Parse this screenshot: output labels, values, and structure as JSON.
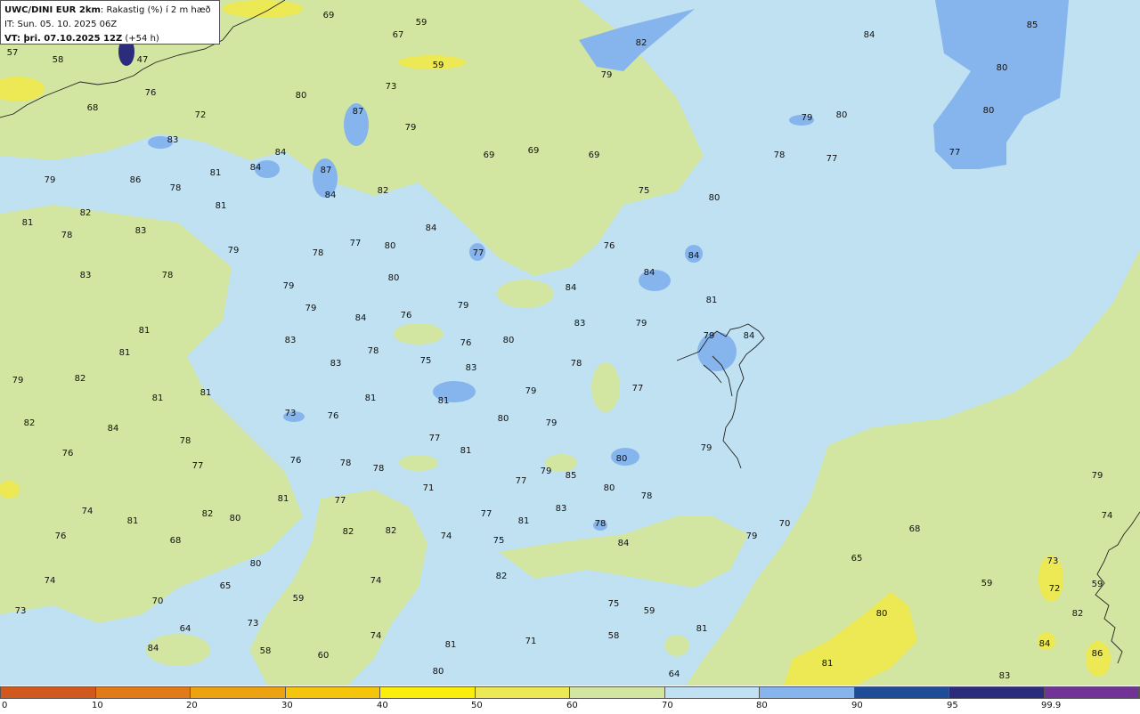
{
  "header": {
    "model": "UWC/DINI EUR 2km",
    "parameter": ": Rakastig (%) í 2 m hæð",
    "it": "IT: Sun. 05. 10. 2025 06Z",
    "vt": "VT: þri. 07.10.2025 12Z",
    "lead": " (+54 h)"
  },
  "legend": {
    "colors": [
      "#d2591e",
      "#e27a18",
      "#eda212",
      "#f5c50c",
      "#fbee0a",
      "#ece954",
      "#d2e6a1",
      "#bfe1f2",
      "#86b5ee",
      "#1f4c96",
      "#2b2d7c",
      "#723396"
    ],
    "ticks": [
      "0",
      "10",
      "20",
      "30",
      "40",
      "50",
      "60",
      "70",
      "80",
      "90",
      "95",
      "99.9"
    ]
  },
  "fill_colors": {
    "ocean": "#bfe1f2",
    "dry": "#d2e6a1",
    "humid": "#86b5ee",
    "very_dry": "#ece954",
    "extreme": "#2b2d7c"
  },
  "values": [
    "69",
    "59",
    "67",
    "59",
    "57",
    "58",
    "47",
    "76",
    "80",
    "73",
    "68",
    "72",
    "87",
    "79",
    "83",
    "69",
    "69",
    "69",
    "84",
    "87",
    "84",
    "86",
    "78",
    "81",
    "84",
    "82",
    "79",
    "81",
    "75",
    "80",
    "82",
    "81",
    "78",
    "83",
    "79",
    "78",
    "77",
    "80",
    "84",
    "77",
    "79",
    "78",
    "80",
    "79",
    "76",
    "84",
    "84",
    "84",
    "76",
    "81",
    "83",
    "84",
    "79",
    "81",
    "80",
    "83",
    "79",
    "76",
    "83",
    "81",
    "76",
    "78",
    "78",
    "77",
    "81",
    "75",
    "79",
    "84",
    "79",
    "82",
    "83",
    "83",
    "81",
    "79",
    "81",
    "80",
    "79",
    "84",
    "77",
    "81",
    "81",
    "82",
    "73",
    "76",
    "78",
    "77",
    "80",
    "79",
    "79",
    "77",
    "85",
    "80",
    "78",
    "76",
    "78",
    "78",
    "71",
    "74",
    "81",
    "77",
    "77",
    "81",
    "83",
    "78",
    "84",
    "81",
    "82",
    "80",
    "82",
    "82",
    "74",
    "75",
    "76",
    "68",
    "80",
    "82",
    "79",
    "70",
    "68",
    "65",
    "65",
    "74",
    "74",
    "79",
    "74",
    "59",
    "59",
    "75",
    "70",
    "73",
    "72",
    "64",
    "73",
    "74",
    "81",
    "58",
    "59",
    "73",
    "81",
    "71",
    "80",
    "59",
    "58",
    "60",
    "80",
    "64",
    "86",
    "81",
    "84",
    "84",
    "83",
    "82",
    "85",
    "84",
    "82",
    "80",
    "80",
    "79",
    "77",
    "79",
    "80",
    "78",
    "77"
  ]
}
